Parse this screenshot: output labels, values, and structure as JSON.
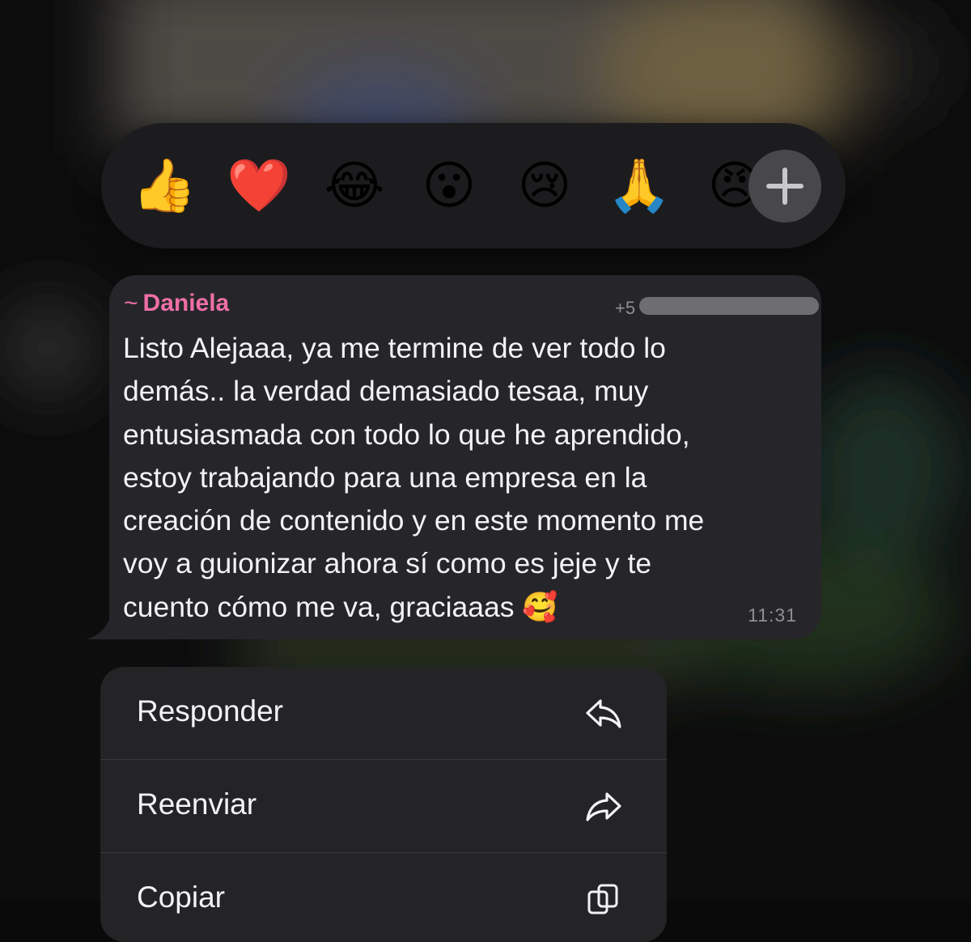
{
  "reactions": [
    {
      "emoji": "👍",
      "name": "thumbs-up"
    },
    {
      "emoji": "❤️",
      "name": "red-heart"
    },
    {
      "emoji": "😂",
      "name": "tears-of-joy"
    },
    {
      "emoji": "😮",
      "name": "surprised-face"
    },
    {
      "emoji": "😢",
      "name": "crying-face"
    },
    {
      "emoji": "🙏",
      "name": "folded-hands"
    },
    {
      "emoji": "😠",
      "name": "angry-face"
    }
  ],
  "message": {
    "sender_prefix": "~",
    "sender_name": "Daniela",
    "phone_visible": "+5",
    "text": "Listo Alejaaa, ya me termine de ver todo lo\ndemás.. la verdad demasiado tesaa, muy\nentusiasmada con todo lo que he aprendido,\nestoy trabajando para una empresa en la\ncreación de contenido y en este momento me\nvoy a guionizar ahora sí como es jeje y te\ncuento cómo me va, graciaaas 🥰",
    "time": "11:31"
  },
  "menu": {
    "items": [
      {
        "label": "Responder",
        "icon": "reply-icon"
      },
      {
        "label": "Reenviar",
        "icon": "forward-icon"
      },
      {
        "label": "Copiar",
        "icon": "copy-icon"
      }
    ]
  },
  "colors": {
    "sender_name": "#ee6fa6",
    "bubble": "#26262a",
    "menu": "#242426",
    "reaction_bar": "#1c1c1e"
  }
}
